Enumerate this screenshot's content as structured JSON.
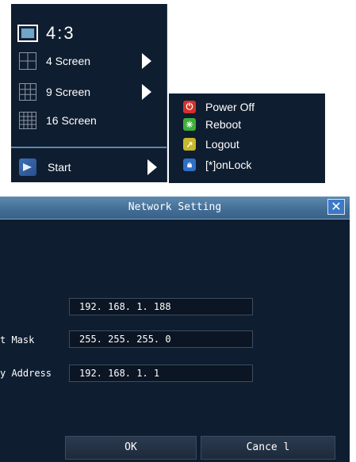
{
  "start_menu": {
    "aspect_label": "4:3",
    "items": [
      {
        "label": "4 Screen"
      },
      {
        "label": "9 Screen"
      },
      {
        "label": "16 Screen"
      }
    ],
    "start_label": "Start"
  },
  "power_menu": {
    "items": [
      {
        "label": "Power Off",
        "icon": "power-icon",
        "color": "#d4312b"
      },
      {
        "label": "Reboot",
        "icon": "reboot-icon",
        "color": "#3fae3a"
      },
      {
        "label": "Logout",
        "icon": "logout-icon",
        "color": "#c8b82a"
      },
      {
        "label": "[*]onLock",
        "icon": "lock-icon",
        "color": "#2f6fc4"
      }
    ]
  },
  "dialog": {
    "title": "Network Setting",
    "fields": [
      {
        "label": "",
        "value": "192. 168. 1. 188"
      },
      {
        "label": "t Mask",
        "value": "255. 255. 255. 0"
      },
      {
        "label": "y Address",
        "value": "192. 168. 1. 1"
      }
    ],
    "ok_label": "OK",
    "cancel_label": "Cance l"
  }
}
